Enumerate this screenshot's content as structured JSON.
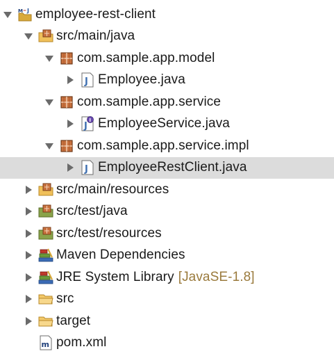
{
  "project_explorer": {
    "project": {
      "label": "employee-rest-client",
      "icon": "maven-java-project-icon",
      "expanded": true
    },
    "items": [
      {
        "label": "src/main/java",
        "icon": "source-folder-icon",
        "expanded": true
      },
      {
        "label": "com.sample.app.model",
        "icon": "package-icon",
        "expanded": true
      },
      {
        "label": "Employee.java",
        "icon": "java-file-icon",
        "expanded": false
      },
      {
        "label": "com.sample.app.service",
        "icon": "package-icon",
        "expanded": true
      },
      {
        "label": "EmployeeService.java",
        "icon": "java-interface-file-icon",
        "expanded": false
      },
      {
        "label": "com.sample.app.service.impl",
        "icon": "package-icon",
        "expanded": true
      },
      {
        "label": "EmployeeRestClient.java",
        "icon": "java-file-icon",
        "expanded": false,
        "selected": true
      },
      {
        "label": "src/main/resources",
        "icon": "source-folder-icon",
        "expanded": false
      },
      {
        "label": "src/test/java",
        "icon": "test-source-folder-icon",
        "expanded": false
      },
      {
        "label": "src/test/resources",
        "icon": "test-source-folder-icon",
        "expanded": false
      },
      {
        "label": "Maven Dependencies",
        "icon": "library-icon",
        "expanded": false
      },
      {
        "label": "JRE System Library",
        "decoration": "[JavaSE-1.8]",
        "icon": "library-icon",
        "expanded": false
      },
      {
        "label": "src",
        "icon": "folder-icon",
        "expanded": false
      },
      {
        "label": "target",
        "icon": "folder-icon",
        "expanded": false
      },
      {
        "label": "pom.xml",
        "icon": "maven-pom-file-icon"
      }
    ]
  },
  "colors": {
    "selection": "#dcdcdc",
    "decoration": "#9a7a3c",
    "package": "#b4693c",
    "folder": "#d9a93b",
    "java": "#3e6fb0"
  }
}
